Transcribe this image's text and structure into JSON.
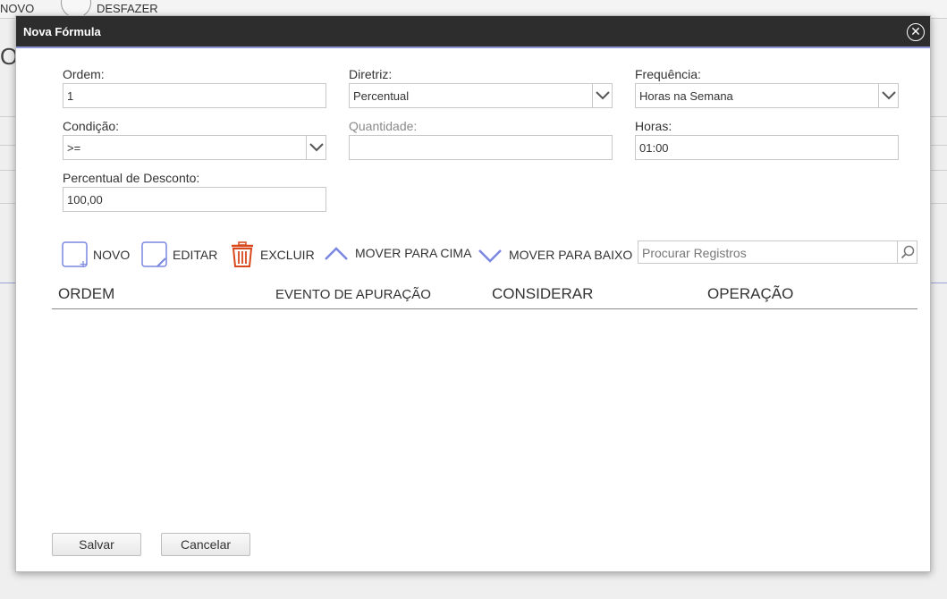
{
  "background": {
    "toolbar": {
      "novo": "NOVO",
      "desfazer": "DESFAZER"
    },
    "page_char": "O"
  },
  "dialog": {
    "title": "Nova Fórmula",
    "close_icon": "close-circle-icon",
    "fields": {
      "ordem": {
        "label": "Ordem:",
        "value": "1"
      },
      "diretriz": {
        "label": "Diretriz:",
        "value": "Percentual"
      },
      "frequencia": {
        "label": "Frequência:",
        "value": "Horas na Semana"
      },
      "condicao": {
        "label": "Condição:",
        "value": ">="
      },
      "quantidade": {
        "label": "Quantidade:",
        "value": ""
      },
      "horas": {
        "label": "Horas:",
        "value": "01:00"
      },
      "percentual": {
        "label": "Percentual de Desconto:",
        "value": "100,00"
      }
    },
    "toolbar": {
      "novo": "NOVO",
      "editar": "EDITAR",
      "excluir": "EXCLUIR",
      "mover_cima": "MOVER PARA CIMA",
      "mover_baixo": "MOVER PARA BAIXO"
    },
    "search": {
      "placeholder": "Procurar Registros"
    },
    "table": {
      "columns": [
        "ORDEM",
        "EVENTO DE APURAÇÃO",
        "CONSIDERAR",
        "OPERAÇÃO"
      ],
      "rows": []
    },
    "buttons": {
      "save": "Salvar",
      "cancel": "Cancelar"
    },
    "colors": {
      "titlebar": "#2d2d2d",
      "accent": "#8d96d6",
      "icon_blue": "#7b86e0",
      "delete_red": "#d9481c"
    }
  }
}
